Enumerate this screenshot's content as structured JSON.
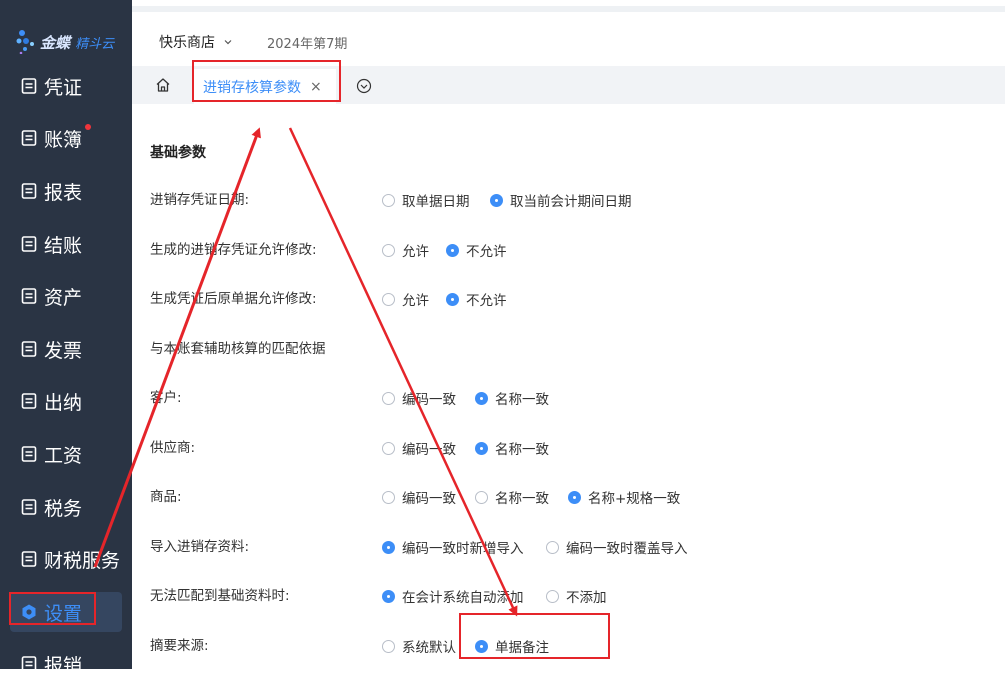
{
  "app": {
    "brand_main": "金蝶",
    "brand_sub": "精斗云"
  },
  "sidebar": {
    "items": [
      {
        "label": "凭证",
        "icon": "voucher-icon"
      },
      {
        "label": "账簿",
        "icon": "ledger-icon",
        "badge_dot": true
      },
      {
        "label": "报表",
        "icon": "report-icon"
      },
      {
        "label": "结账",
        "icon": "closing-icon"
      },
      {
        "label": "资产",
        "icon": "asset-icon"
      },
      {
        "label": "发票",
        "icon": "invoice-icon"
      },
      {
        "label": "出纳",
        "icon": "cashier-icon"
      },
      {
        "label": "工资",
        "icon": "salary-icon"
      },
      {
        "label": "税务",
        "icon": "tax-icon"
      },
      {
        "label": "财税服务",
        "icon": "service-icon"
      },
      {
        "label": "设置",
        "icon": "settings-icon",
        "active": true
      },
      {
        "label": "报销",
        "icon": "reimburse-icon"
      }
    ]
  },
  "header": {
    "store": "快乐商店",
    "period": "2024年第7期"
  },
  "tabs": {
    "active_label": "进销存核算参数",
    "close": "×"
  },
  "form": {
    "section_title": "基础参数",
    "subheading": "与本账套辅助核算的匹配依据",
    "rows": [
      {
        "label": "进销存凭证日期:",
        "options": [
          "取单据日期",
          "取当前会计期间日期"
        ],
        "selected": 1
      },
      {
        "label": "生成的进销存凭证允许修改:",
        "options": [
          "允许",
          "不允许"
        ],
        "selected": 1
      },
      {
        "label": "生成凭证后原单据允许修改:",
        "options": [
          "允许",
          "不允许"
        ],
        "selected": 1
      },
      {
        "label": "客户:",
        "options": [
          "编码一致",
          "名称一致"
        ],
        "selected": 1
      },
      {
        "label": "供应商:",
        "options": [
          "编码一致",
          "名称一致"
        ],
        "selected": 1
      },
      {
        "label": "商品:",
        "options": [
          "编码一致",
          "名称一致",
          "名称+规格一致"
        ],
        "selected": 2
      },
      {
        "label": "导入进销存资料:",
        "options": [
          "编码一致时新增导入",
          "编码一致时覆盖导入"
        ],
        "selected": 0
      },
      {
        "label": "无法匹配到基础资料时:",
        "options": [
          "在会计系统自动添加",
          "不添加"
        ],
        "selected": 0
      },
      {
        "label": "摘要来源:",
        "options": [
          "系统默认",
          "单据备注"
        ],
        "selected": 1
      }
    ]
  },
  "colors": {
    "accent": "#3d8ef7",
    "sidebar_bg": "#2a3444",
    "annotation": "#e5252a"
  }
}
